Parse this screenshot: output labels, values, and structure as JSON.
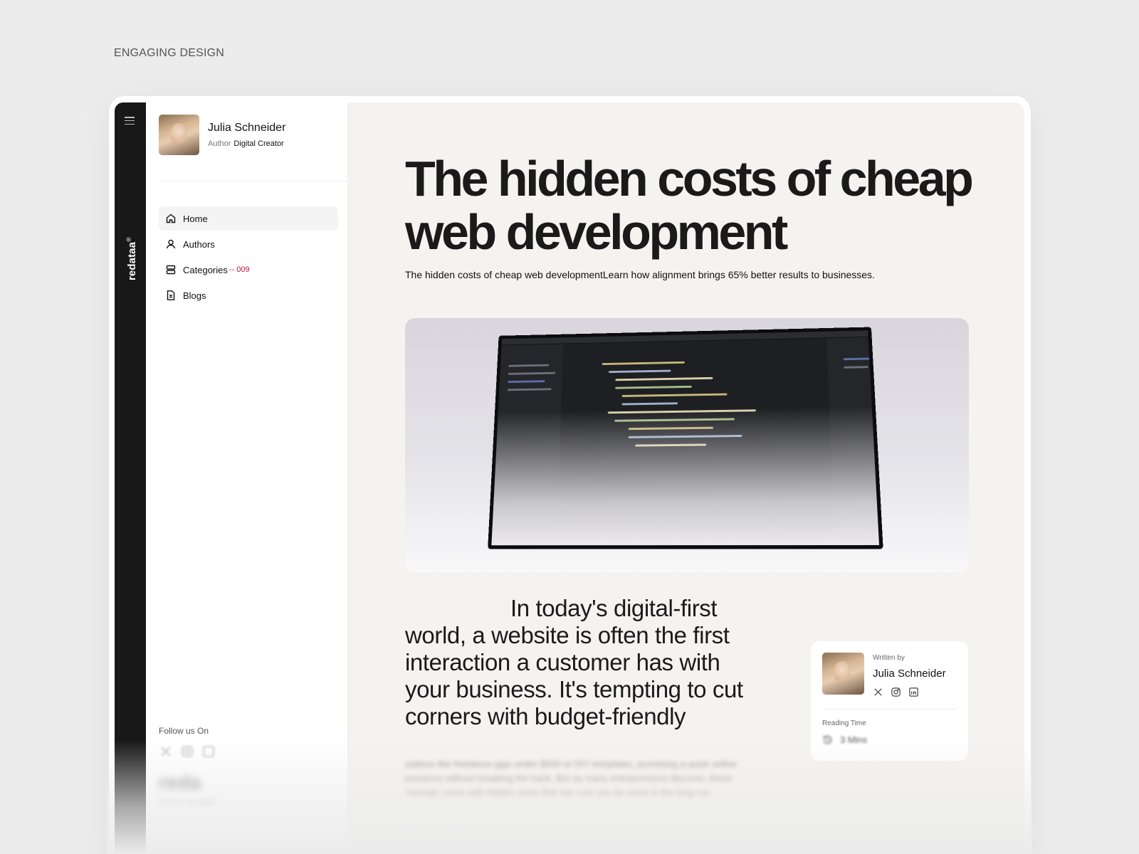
{
  "eyebrow": "ENGAGING DESIGN",
  "rail": {
    "brand": "redataa",
    "brand_mark": "®"
  },
  "profile": {
    "name": "Julia Schneider",
    "role_label": "Author",
    "role_value": "Digital Creator"
  },
  "nav": {
    "items": [
      {
        "label": "Home",
        "icon": "home-icon",
        "active": true
      },
      {
        "label": "Authors",
        "icon": "user-icon"
      },
      {
        "label": "Categories",
        "icon": "categories-icon",
        "count": "-- 009"
      },
      {
        "label": "Blogs",
        "icon": "document-icon"
      }
    ]
  },
  "follow": {
    "label": "Follow us On",
    "logo": "reda",
    "copyright": "© 2024 all rights"
  },
  "article": {
    "title": "The hidden costs of cheap web development",
    "subtitle": "The hidden costs of cheap web developmentLearn how alignment brings 65% better results to businesses.",
    "lede": "In today's digital-first world, a website is often the first interaction a customer has with your business. It's tempting to cut corners with budget-friendly",
    "body_faded": "options like freelance gigs under $500 or DIY templates, promising a quick online presence without breaking the bank. But as many entrepreneurs discover, these 'savings' come with hidden costs that can cost you far more in the long run."
  },
  "author_card": {
    "written_by": "Written by",
    "name": "Julia Schneider",
    "reading_label": "Reading Time",
    "reading_value": "3 Mins"
  },
  "colors": {
    "accent": "#c0163c",
    "rail": "#181818",
    "main_bg": "#f4f3f0"
  }
}
